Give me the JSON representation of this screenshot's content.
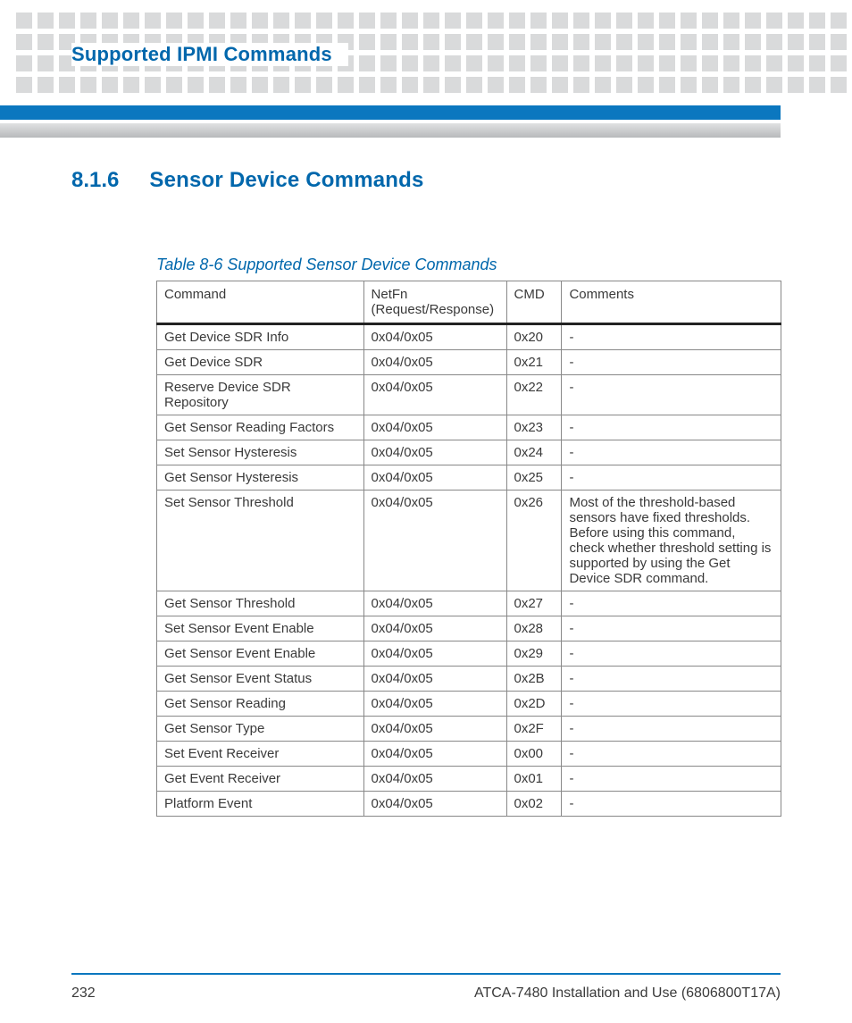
{
  "header": {
    "title": "Supported IPMI Commands"
  },
  "section": {
    "number": "8.1.6",
    "title": "Sensor Device Commands"
  },
  "table": {
    "caption": "Table 8-6 Supported Sensor Device Commands",
    "headers": {
      "command": "Command",
      "netfn": "NetFn (Request/Response)",
      "cmd": "CMD",
      "comments": "Comments"
    },
    "rows": [
      {
        "command": "Get Device SDR Info",
        "netfn": "0x04/0x05",
        "cmd": "0x20",
        "comments": "-"
      },
      {
        "command": "Get Device SDR",
        "netfn": "0x04/0x05",
        "cmd": "0x21",
        "comments": "-"
      },
      {
        "command": "Reserve Device SDR Repository",
        "netfn": "0x04/0x05",
        "cmd": "0x22",
        "comments": "-"
      },
      {
        "command": "Get Sensor Reading Factors",
        "netfn": "0x04/0x05",
        "cmd": "0x23",
        "comments": "-"
      },
      {
        "command": "Set Sensor Hysteresis",
        "netfn": "0x04/0x05",
        "cmd": "0x24",
        "comments": "-"
      },
      {
        "command": "Get Sensor Hysteresis",
        "netfn": "0x04/0x05",
        "cmd": "0x25",
        "comments": "-"
      },
      {
        "command": "Set Sensor Threshold",
        "netfn": "0x04/0x05",
        "cmd": "0x26",
        "comments": "Most of the threshold-based sensors have fixed thresholds. Before using this command, check whether threshold setting is supported by using the Get Device SDR command."
      },
      {
        "command": "Get Sensor Threshold",
        "netfn": "0x04/0x05",
        "cmd": "0x27",
        "comments": "-"
      },
      {
        "command": "Set Sensor Event Enable",
        "netfn": "0x04/0x05",
        "cmd": "0x28",
        "comments": "-"
      },
      {
        "command": "Get Sensor Event Enable",
        "netfn": "0x04/0x05",
        "cmd": "0x29",
        "comments": "-"
      },
      {
        "command": "Get Sensor Event Status",
        "netfn": "0x04/0x05",
        "cmd": "0x2B",
        "comments": "-"
      },
      {
        "command": "Get Sensor Reading",
        "netfn": "0x04/0x05",
        "cmd": "0x2D",
        "comments": "-"
      },
      {
        "command": "Get Sensor Type",
        "netfn": "0x04/0x05",
        "cmd": "0x2F",
        "comments": "-"
      },
      {
        "command": "Set Event Receiver",
        "netfn": "0x04/0x05",
        "cmd": "0x00",
        "comments": "-"
      },
      {
        "command": "Get Event Receiver",
        "netfn": "0x04/0x05",
        "cmd": "0x01",
        "comments": "-"
      },
      {
        "command": "Platform Event",
        "netfn": "0x04/0x05",
        "cmd": "0x02",
        "comments": "-"
      }
    ]
  },
  "footer": {
    "page": "232",
    "docref": "ATCA-7480 Installation and Use (6806800T17A)"
  }
}
